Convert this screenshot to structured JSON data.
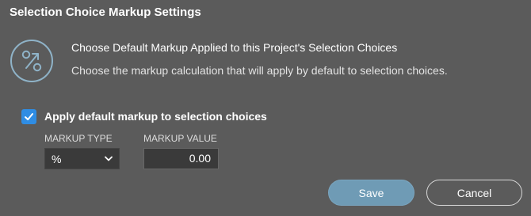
{
  "dialog": {
    "title": "Selection Choice Markup Settings"
  },
  "info": {
    "icon": "percent-circle-icon",
    "heading": "Choose Default Markup Applied to this Project's Selection Choices",
    "description": "Choose the markup calculation that will apply by default to selection choices."
  },
  "apply_default": {
    "checked": true,
    "label": "Apply default markup to selection choices"
  },
  "markup_type": {
    "label": "MARKUP TYPE",
    "value": "%"
  },
  "markup_value": {
    "label": "MARKUP VALUE",
    "value": "0.00"
  },
  "buttons": {
    "save": "Save",
    "cancel": "Cancel"
  },
  "colors": {
    "background": "#5b5b5b",
    "checkbox": "#2f8de4",
    "save_button": "#6f9bb5",
    "field_background": "#3a3a3a"
  }
}
